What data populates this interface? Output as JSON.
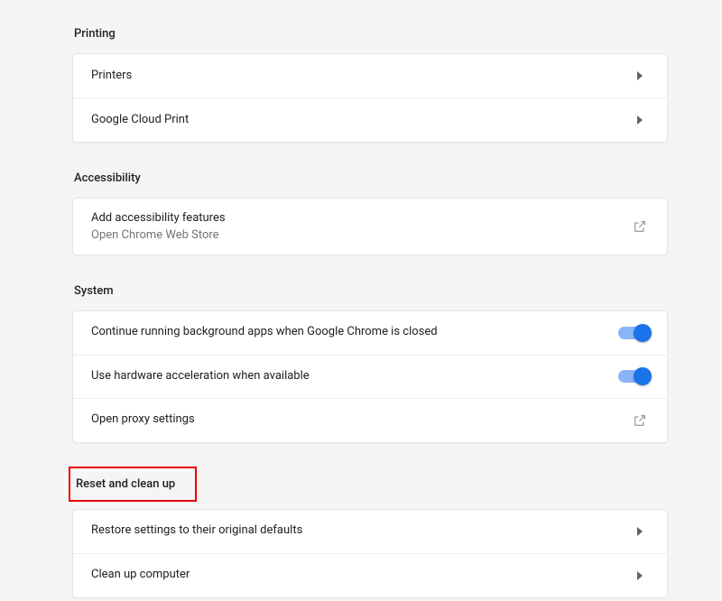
{
  "sections": {
    "printing": {
      "title": "Printing",
      "items": {
        "printers": "Printers",
        "cloud_print": "Google Cloud Print"
      }
    },
    "accessibility": {
      "title": "Accessibility",
      "items": {
        "add_features": "Add accessibility features",
        "add_features_sub": "Open Chrome Web Store"
      }
    },
    "system": {
      "title": "System",
      "items": {
        "background_apps": "Continue running background apps when Google Chrome is closed",
        "hardware_accel": "Use hardware acceleration when available",
        "proxy": "Open proxy settings"
      }
    },
    "reset": {
      "title": "Reset and clean up",
      "items": {
        "restore": "Restore settings to their original defaults",
        "cleanup": "Clean up computer"
      }
    }
  }
}
